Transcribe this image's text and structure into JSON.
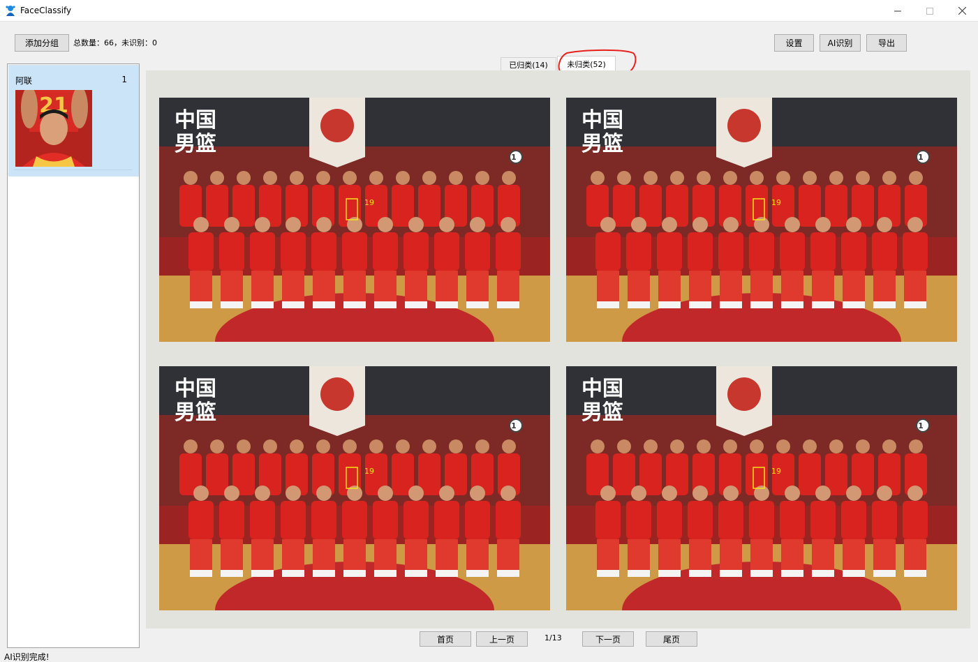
{
  "window": {
    "title": "FaceClassify"
  },
  "toolbar": {
    "add_group": "添加分组",
    "stats": "总数量：66，未识别：0",
    "settings": "设置",
    "ai_recognize": "AI识别",
    "export": "导出"
  },
  "tabs": [
    {
      "label": "已归类(14)",
      "selected": false
    },
    {
      "label": "未归类(52)",
      "selected": true
    }
  ],
  "sidebar": {
    "groups": [
      {
        "name": "阿联",
        "count": "1"
      }
    ]
  },
  "photos": [
    {
      "headline_top": "中国",
      "headline_bottom": "男篮",
      "face_label": "19",
      "badge": "1"
    },
    {
      "headline_top": "中国",
      "headline_bottom": "男篮",
      "face_label": "19",
      "badge": "1"
    },
    {
      "headline_top": "中国",
      "headline_bottom": "男篮",
      "face_label": "19",
      "badge": "1"
    },
    {
      "headline_top": "中国",
      "headline_bottom": "男篮",
      "face_label": "19",
      "badge": "1"
    }
  ],
  "pagination": {
    "first": "首页",
    "prev": "上一页",
    "info": "1/13",
    "next": "下一页",
    "last": "尾页"
  },
  "status": {
    "text": "AI识别完成!"
  },
  "colors": {
    "accent": "#cce4f7",
    "jersey": "#d8231f",
    "face_box": "#f5e21a",
    "annotation": "#e8201b"
  }
}
